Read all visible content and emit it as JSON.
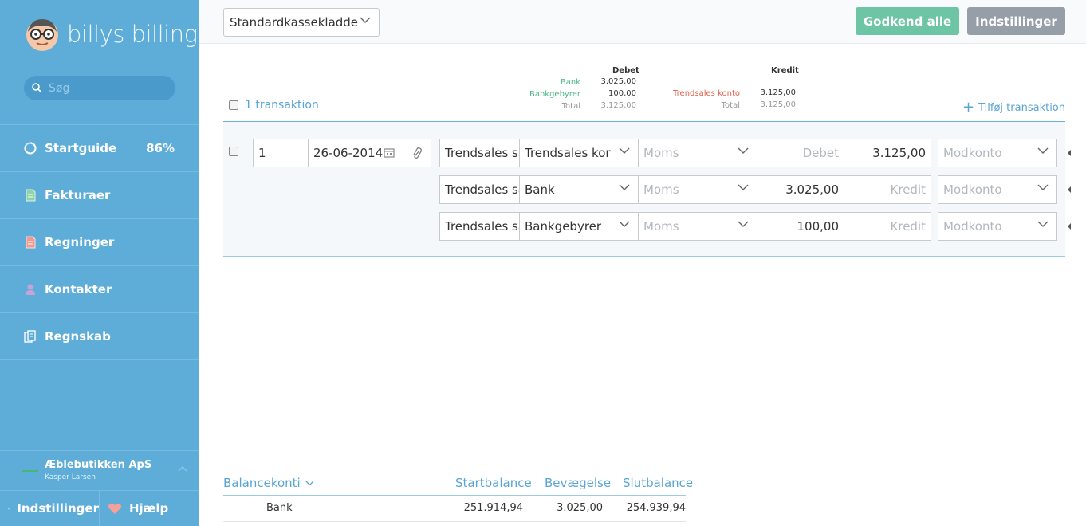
{
  "app": {
    "logo_text": "billys billing"
  },
  "search": {
    "placeholder": "Søg"
  },
  "nav": {
    "items": [
      {
        "label": "Startguide",
        "icon": "progress-ring-icon",
        "badge": "86%"
      },
      {
        "label": "Fakturaer",
        "icon": "invoice-icon"
      },
      {
        "label": "Regninger",
        "icon": "bill-icon"
      },
      {
        "label": "Kontakter",
        "icon": "contact-icon"
      },
      {
        "label": "Regnskab",
        "icon": "ledger-icon"
      }
    ]
  },
  "company": {
    "name": "Æblebutikken ApS",
    "user": "Kasper Larsen"
  },
  "footer": {
    "settings_label": "Indstillinger",
    "help_label": "Hjælp"
  },
  "topbar": {
    "journal_selected": "Standardkassekladde",
    "approve_all_label": "Godkend alle",
    "settings_label": "Indstillinger"
  },
  "summary": {
    "tx_count_label": "1 transaktion",
    "debit_header": "Debet",
    "credit_header": "Kredit",
    "debit_rows": [
      {
        "label": "Bank",
        "value": "3.025,00"
      },
      {
        "label": "Bankgebyrer",
        "value": "100,00"
      },
      {
        "label": "Total",
        "value": "3.125,00"
      }
    ],
    "credit_rows": [
      {
        "label": "Trendsales konto",
        "value": "3.125,00"
      },
      {
        "label": "Total",
        "value": "3.125,00"
      }
    ],
    "add_transaction_label": "Tilføj transaktion"
  },
  "transaction": {
    "number": "1",
    "date": "26-06-2014",
    "lines": [
      {
        "description": "Trendsales sa",
        "account": "Trendsales konto",
        "vat_placeholder": "Moms",
        "debit": "",
        "debit_placeholder": "Debet",
        "credit": "3.125,00",
        "credit_placeholder": "Kredit",
        "contra_placeholder": "Modkonto"
      },
      {
        "description": "Trendsales sa",
        "account": "Bank",
        "vat_placeholder": "Moms",
        "debit": "3.025,00",
        "debit_placeholder": "Debet",
        "credit": "",
        "credit_placeholder": "Kredit",
        "contra_placeholder": "Modkonto"
      },
      {
        "description": "Trendsales sa",
        "account": "Bankgebyrer",
        "vat_placeholder": "Moms",
        "debit": "100,00",
        "debit_placeholder": "Debet",
        "credit": "",
        "credit_placeholder": "Kredit",
        "contra_placeholder": "Modkonto"
      }
    ]
  },
  "balance": {
    "headers": {
      "account": "Balancekonti",
      "start": "Startbalance",
      "movement": "Bevægelse",
      "end": "Slutbalance"
    },
    "rows": [
      {
        "account": "Bank",
        "start": "251.914,94",
        "movement": "3.025,00",
        "end": "254.939,94"
      }
    ]
  },
  "colors": {
    "sidebar": "#5dadd8",
    "accent": "#5aa5d2",
    "approve": "#6ec5a5",
    "secondary_button": "#969fa7",
    "debit_label": "#4fb68c",
    "credit_label": "#e0604a"
  }
}
